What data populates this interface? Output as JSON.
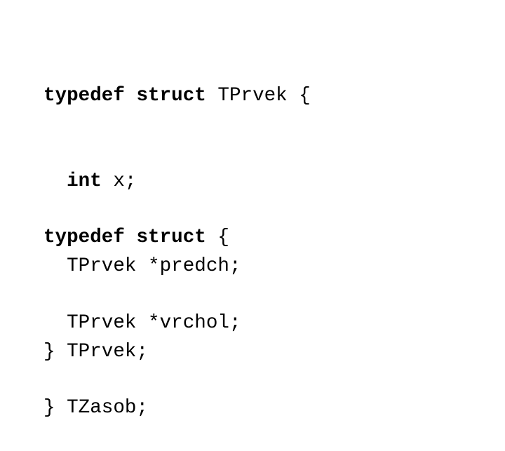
{
  "document": {
    "code_blocks": [
      {
        "lines": [
          {
            "indent": "",
            "keyword": "typedef struct",
            "text": " TPrvek {"
          },
          {
            "indent": "  ",
            "keyword": "int",
            "text": " x;"
          },
          {
            "indent": "  ",
            "keyword": "",
            "text": "TPrvek *predch;"
          },
          {
            "indent": "",
            "keyword": "",
            "text": "} TPrvek;"
          }
        ]
      },
      {
        "lines": [
          {
            "indent": "",
            "keyword": "typedef struct",
            "text": " {"
          },
          {
            "indent": "  ",
            "keyword": "",
            "text": "TPrvek *vrchol;"
          },
          {
            "indent": "",
            "keyword": "",
            "text": "} TZasob;"
          }
        ]
      }
    ]
  }
}
